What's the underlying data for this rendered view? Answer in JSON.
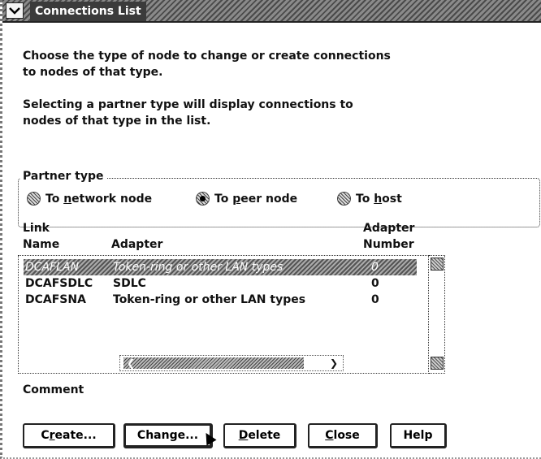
{
  "window": {
    "title": "Connections List"
  },
  "instructions": {
    "line1": "Choose the type of node to change or create connections",
    "line2": "to nodes of that type.",
    "line3": "Selecting a partner type will display connections to",
    "line4": "nodes of that type in the list."
  },
  "partner_type": {
    "legend": "Partner type",
    "options": [
      {
        "pre": "To ",
        "mnemonic": "n",
        "post": "etwork node",
        "checked": false
      },
      {
        "pre": "To ",
        "mnemonic": "p",
        "post": "eer node",
        "checked": true
      },
      {
        "pre": "To ",
        "mnemonic": "h",
        "post": "ost",
        "checked": false
      }
    ]
  },
  "list": {
    "headers": {
      "link_line1": "Link",
      "link_line2": "Name",
      "adapter": "Adapter",
      "adapter_num_line1": "Adapter",
      "adapter_num_line2": "Number"
    },
    "rows": [
      {
        "name": "DCAFLAN",
        "adapter": "Token-ring or other LAN types",
        "number": "0",
        "selected": true
      },
      {
        "name": "DCAFSDLC",
        "adapter": "SDLC",
        "number": "0",
        "selected": false
      },
      {
        "name": "DCAFSNA",
        "adapter": "Token-ring or other LAN types",
        "number": "0",
        "selected": false
      }
    ]
  },
  "comment_label": "Comment",
  "buttons": {
    "create": {
      "mnemonic": "r",
      "pre": "C",
      "post": "eate..."
    },
    "change": {
      "label": "Change..."
    },
    "delete": {
      "mnemonic": "D",
      "pre": "",
      "post": "elete"
    },
    "close": {
      "mnemonic": "C",
      "pre": "",
      "post": "lose"
    },
    "help": {
      "label": "Help"
    }
  },
  "icons": {
    "system_menu": "system-menu-icon",
    "scroll_up": "scroll-up-icon",
    "scroll_down": "scroll-down-icon",
    "scroll_left": "scroll-left-icon",
    "scroll_right": "scroll-right-icon",
    "mouse_pointer": "mouse-pointer-icon"
  }
}
